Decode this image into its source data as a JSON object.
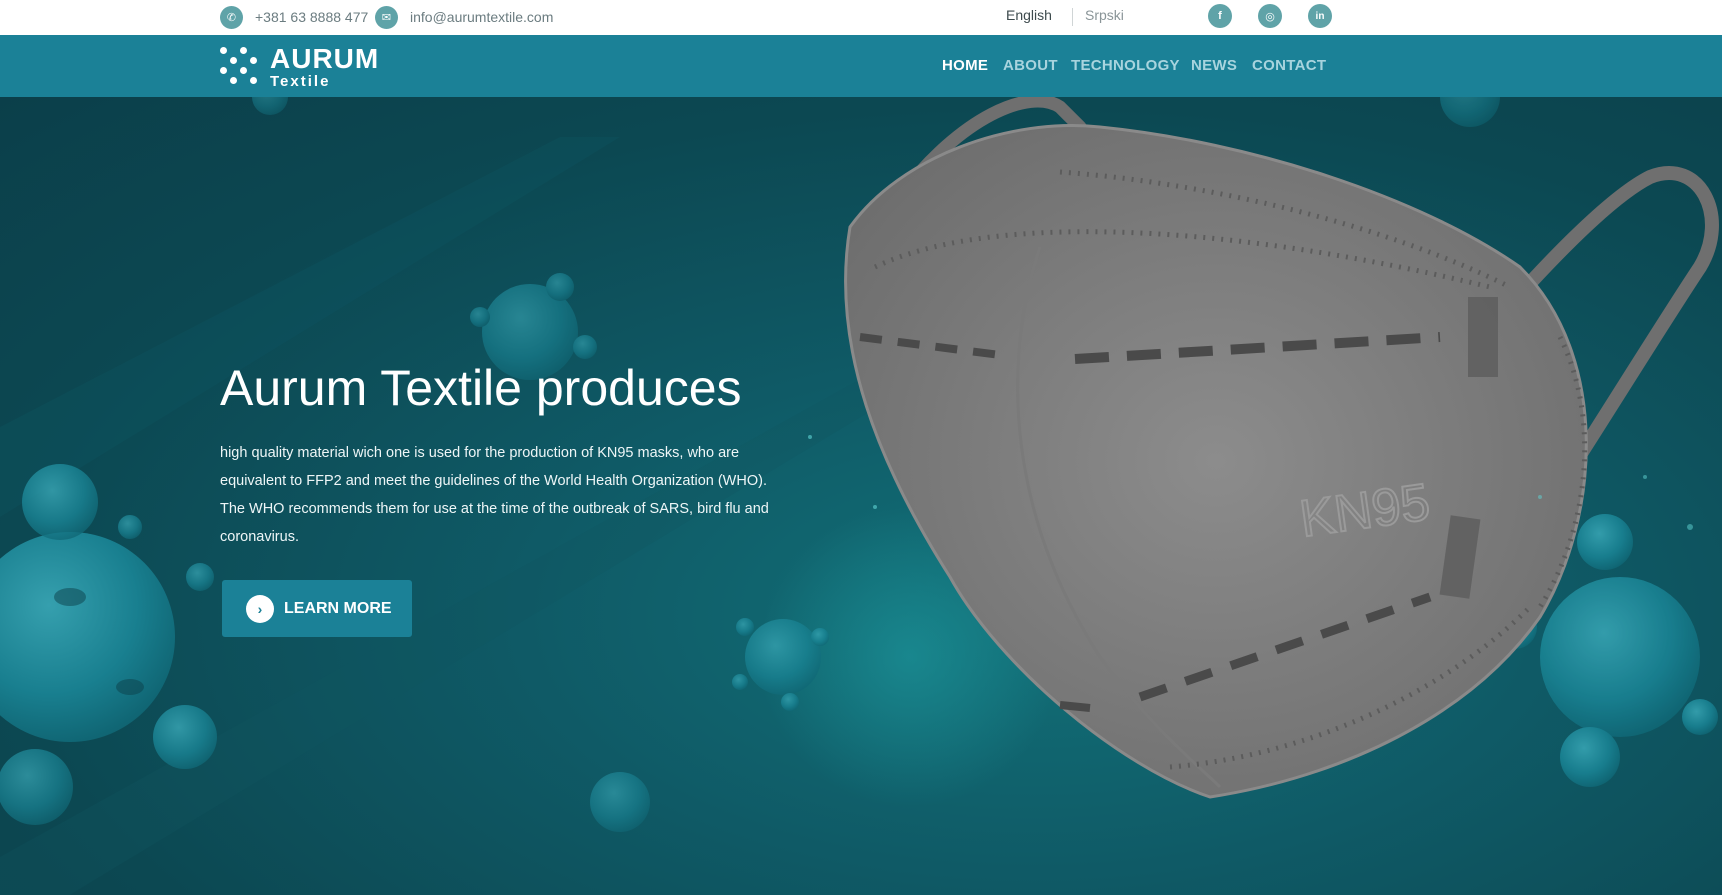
{
  "topbar": {
    "phone": "+381 63 8888 477",
    "email": "info@aurumtextile.com",
    "languages": [
      "English",
      "Srpski"
    ],
    "social": [
      {
        "icon": "facebook-icon",
        "glyph": "f"
      },
      {
        "icon": "instagram-icon",
        "glyph": "◎"
      },
      {
        "icon": "linkedin-icon",
        "glyph": "in"
      }
    ]
  },
  "logo": {
    "name": "AURUM",
    "sub": "Textile"
  },
  "nav": [
    "HOME",
    "ABOUT",
    "TECHNOLOGY",
    "NEWS",
    "CONTACT"
  ],
  "hero": {
    "title": "Aurum Textile produces",
    "text": "high quality material wich one is used for the production of KN95 masks, who are equivalent to FFP2 and meet the guidelines of the World Health Organization (WHO). The WHO recommends them for use at the time of the outbreak of SARS, bird flu and coronavirus.",
    "button": "LEARN MORE",
    "mask_label": "KN95"
  },
  "colors": {
    "accent": "#1b8197",
    "icon_bg": "#5fa3a8",
    "hero_bg": "#0d4a55"
  }
}
